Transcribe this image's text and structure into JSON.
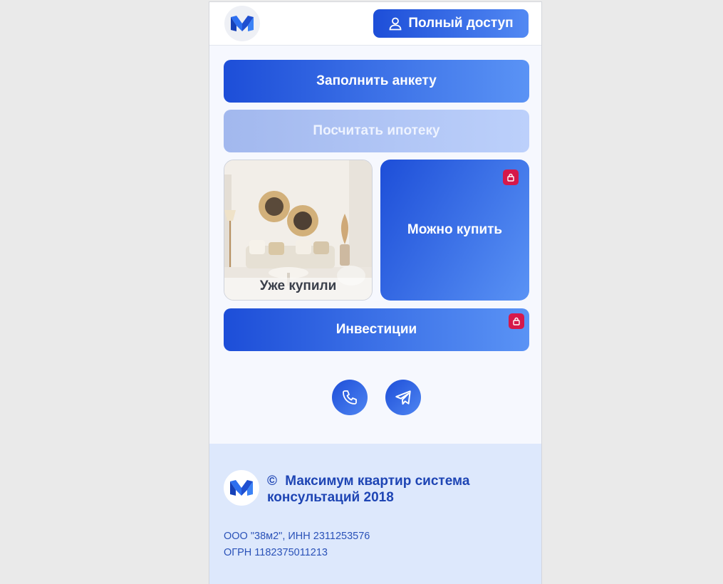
{
  "header": {
    "logo": "logo-m",
    "access_button": {
      "icon": "user-icon",
      "label": "Полный доступ"
    }
  },
  "menu": {
    "fill_form": "Заполнить анкету",
    "mortgage": "Посчитать ипотеку",
    "bought": "Уже купили",
    "can_buy": "Можно купить",
    "investments": "Инвестиции"
  },
  "contacts": {
    "phone_icon": "phone-icon",
    "telegram_icon": "telegram-icon"
  },
  "footer": {
    "copyright": "©",
    "title": "Максимум квартир система консультаций 2018",
    "company": "ООО \"38м2\", ИНН 2311253576",
    "ogrn": "ОГРН 1182375011213"
  },
  "colors": {
    "accent_start": "#1d4ed8",
    "accent_end": "#5a93f5",
    "lock": "#d6184a",
    "footer_bg": "#dde8fc"
  }
}
